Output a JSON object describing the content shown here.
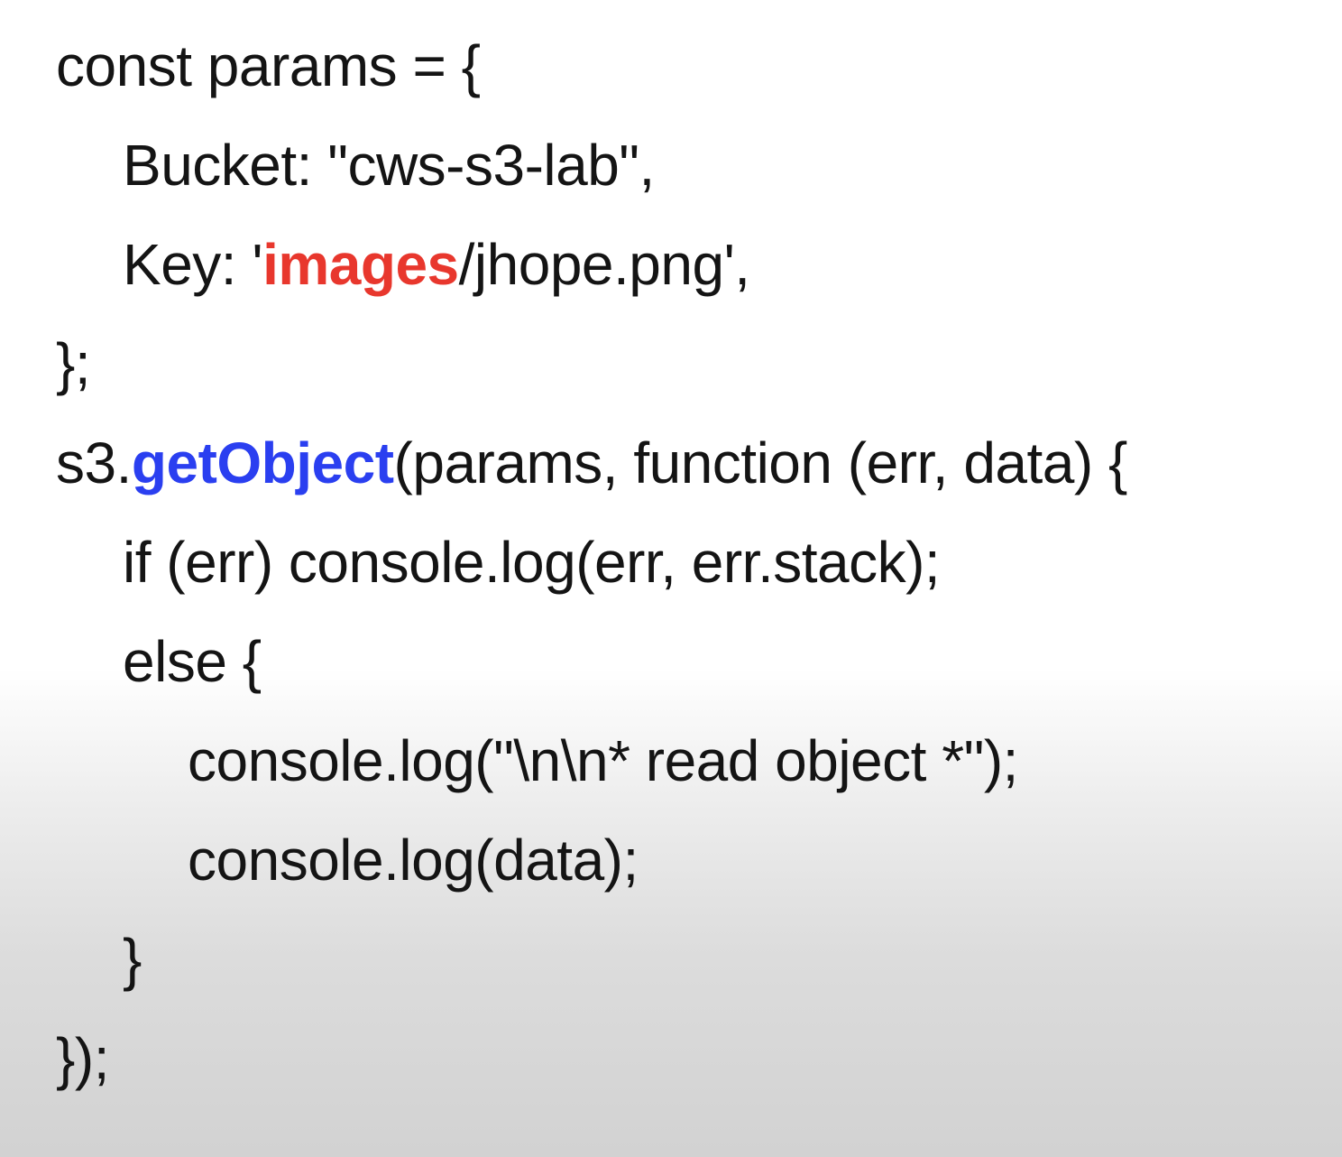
{
  "code": {
    "line1": {
      "text": "const params = {"
    },
    "line2": {
      "text": "Bucket: \"cws-s3-lab\","
    },
    "line3": {
      "prefix": "Key: '",
      "highlight": "images",
      "suffix": "/jhope.png',"
    },
    "line4": {
      "text": "};"
    },
    "line5": {
      "prefix": "s3.",
      "highlight": "getObject",
      "suffix": "(params, function (err, data) {"
    },
    "line6": {
      "text": "if (err) console.log(err, err.stack);"
    },
    "line7": {
      "text": "else {"
    },
    "line8": {
      "text": "console.log(\"\\n\\n* read object *\");"
    },
    "line9": {
      "text": "console.log(data);"
    },
    "line10": {
      "text": "}"
    },
    "line11": {
      "text": "});"
    }
  },
  "colors": {
    "highlight_path": "#e8372d",
    "highlight_method": "#2a3ff0",
    "text": "#141414"
  }
}
